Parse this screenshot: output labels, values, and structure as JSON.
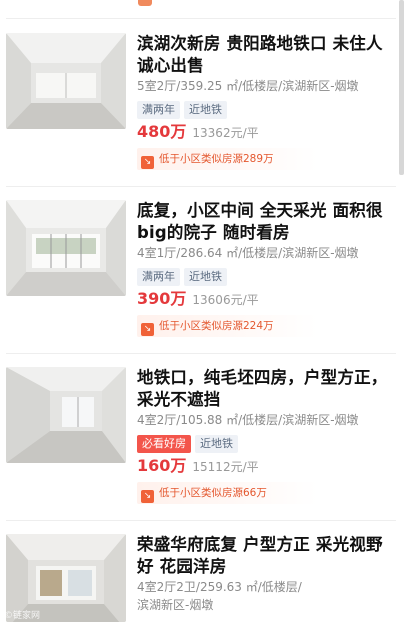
{
  "listings": [
    {
      "title": "滨湖次新房 贵阳路地铁口 未住人诚心出售",
      "meta": "5室2厅/359.25 ㎡/低楼层/滨湖新区-烟墩",
      "tags": [
        "满两年",
        "近地铁"
      ],
      "price": "480万",
      "unit_price": "13362元/平",
      "compare": "低于小区类似房源289万"
    },
    {
      "title": "底复，小区中间 全天采光 面积很big的院子 随时看房",
      "meta": "4室1厅/286.64 ㎡/低楼层/滨湖新区-烟墩",
      "tags": [
        "满两年",
        "近地铁"
      ],
      "price": "390万",
      "unit_price": "13606元/平",
      "compare": "低于小区类似房源224万"
    },
    {
      "title": "地铁口，纯毛坯四房，户型方正，采光不遮挡",
      "meta": "4室2厅/105.88 ㎡/低楼层/滨湖新区-烟墩",
      "tags": [
        "必看好房",
        "近地铁"
      ],
      "price": "160万",
      "unit_price": "15112元/平",
      "compare": "低于小区类似房源66万"
    },
    {
      "title": "荣盛华府底复 户型方正 采光视野好 花园洋房",
      "meta": "4室2厅2卫/259.63 ㎡/低楼层/",
      "meta2": "滨湖新区-烟墩"
    }
  ],
  "watermark": "©链家网",
  "icons": {
    "compare": "down-arrow-icon"
  },
  "colors": {
    "price": "#e4393c",
    "hot_tag": "#f3554b",
    "accent": "#f06238"
  }
}
